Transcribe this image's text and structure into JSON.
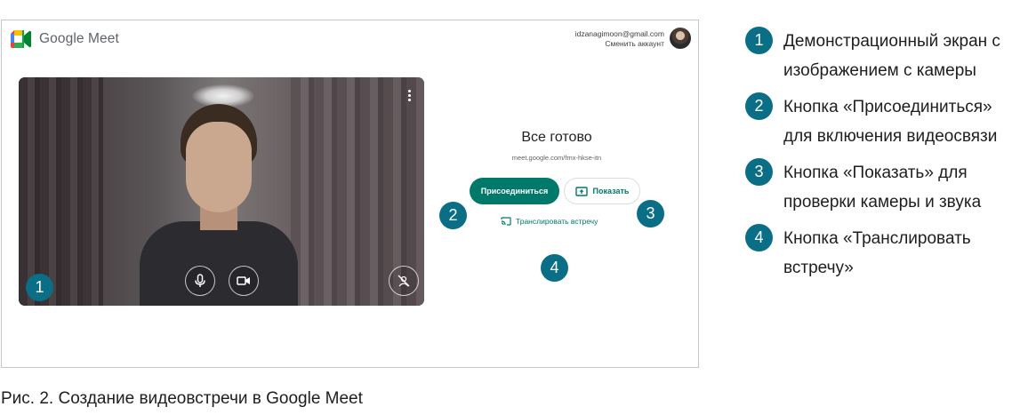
{
  "app": {
    "name": "Google Meet"
  },
  "account": {
    "email": "idzanagimoon@gmail.com",
    "switch_label": "Сменить аккаунт"
  },
  "preview": {
    "controls": [
      "microphone-icon",
      "camera-icon",
      "visual-effects-icon"
    ],
    "menu_icon": "more-vert-icon"
  },
  "ready": {
    "title": "Все готово",
    "meeting_url": "meet.google.com/fmx-hkse-itn",
    "join_label": "Присоединиться",
    "present_label": "Показать",
    "cast_label": "Транслировать встречу"
  },
  "badges": [
    "1",
    "2",
    "3",
    "4"
  ],
  "legend": [
    {
      "num": "1",
      "text": "Демонстрационный экран с изображением с камеры"
    },
    {
      "num": "2",
      "text": "Кнопка «Присоединиться» для включения видеосвязи"
    },
    {
      "num": "3",
      "text": "Кнопка «Показать» для проверки камеры и звука"
    },
    {
      "num": "4",
      "text": "Кнопка «Транслировать встречу»"
    }
  ],
  "caption": "Рис. 2. Создание видеовстречи в Google Meet",
  "colors": {
    "accent": "#00796b",
    "badge": "#0a6e86"
  }
}
